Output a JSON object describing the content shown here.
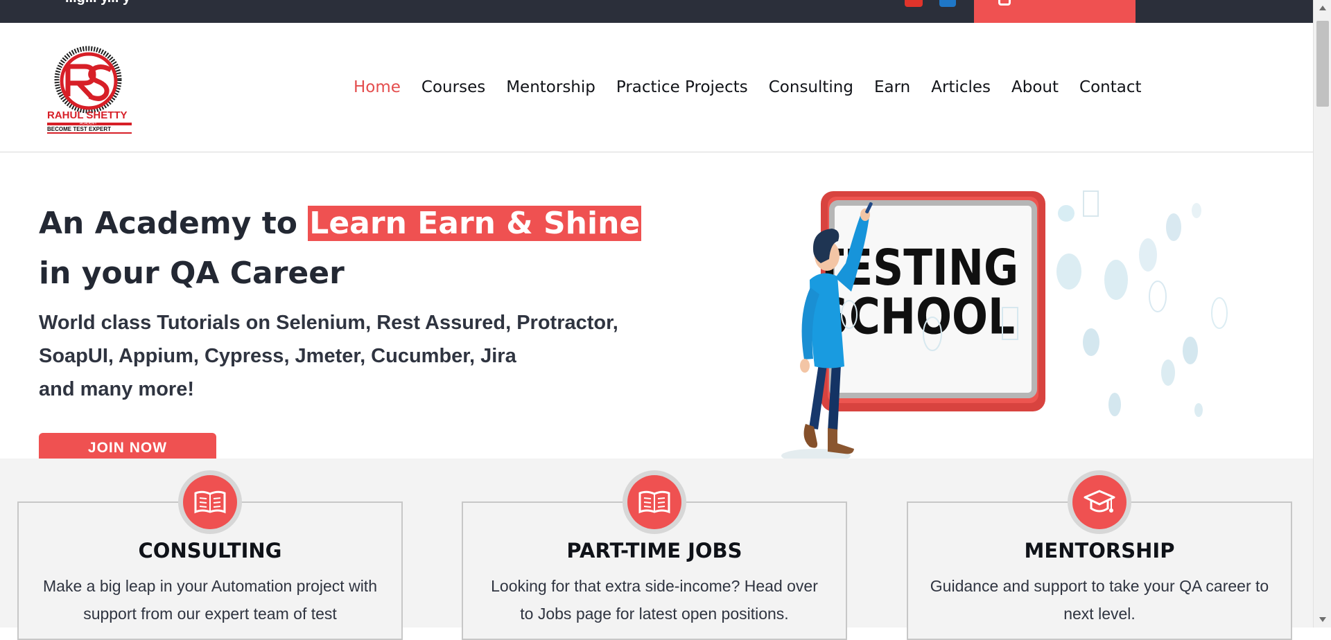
{
  "topbar": {
    "partial_text": "...g... y... y",
    "social_icons": [
      "youtube-icon",
      "linkedin-icon"
    ],
    "cta_icon": "instagram-icon"
  },
  "header": {
    "logo": {
      "name": "RAHUL SHETTY",
      "sub": "ACADEMY",
      "tagline": "BECOME TEST EXPERT"
    },
    "nav": [
      {
        "label": "Home",
        "active": true
      },
      {
        "label": "Courses",
        "active": false
      },
      {
        "label": "Mentorship",
        "active": false
      },
      {
        "label": "Practice Projects",
        "active": false
      },
      {
        "label": "Consulting",
        "active": false
      },
      {
        "label": "Earn",
        "active": false
      },
      {
        "label": "Articles",
        "active": false
      },
      {
        "label": "About",
        "active": false
      },
      {
        "label": "Contact",
        "active": false
      }
    ]
  },
  "hero": {
    "title_prefix": "An Academy to ",
    "title_highlight": "Learn Earn & Shine",
    "title_line2": "in your QA Career",
    "subtitle_lines": [
      "World class Tutorials on Selenium, Rest Assured, Protractor,",
      "SoapUI, Appium, Cypress, Jmeter, Cucumber, Jira",
      "and many more!"
    ],
    "join_button": "JOIN NOW",
    "illustration_text": [
      "TESTING",
      "SCHOOL"
    ]
  },
  "features": [
    {
      "icon": "book-icon",
      "title": "CONSULTING",
      "text": "Make a big leap in your Automation project with support from our expert team of test"
    },
    {
      "icon": "book-icon",
      "title": "PART-TIME JOBS",
      "text": "Looking for that extra side-income? Head over to Jobs page for latest open positions."
    },
    {
      "icon": "graduation-cap-icon",
      "title": "MENTORSHIP",
      "text": "Guidance and support to take your QA career to next level."
    }
  ],
  "colors": {
    "accent": "#ef5151",
    "dark_topbar": "#2b2f3a",
    "section_bg": "#f3f3f3"
  }
}
